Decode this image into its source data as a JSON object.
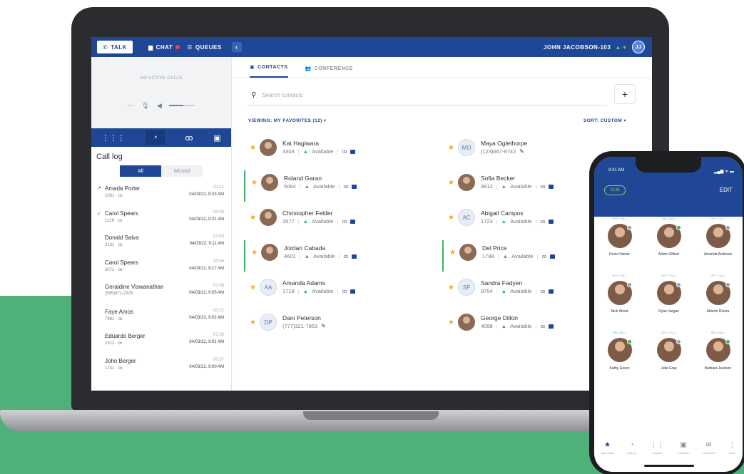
{
  "topbar": {
    "talk": "TALK",
    "chat": "CHAT",
    "queues": "QUEUES",
    "collapse": "‹",
    "user": "JOHN JACOBSON-103",
    "avatar": "JJ"
  },
  "left": {
    "no_calls": "NO ACTIVE CALLS",
    "call_log_title": "Call log",
    "filter_all": "All",
    "filter_missed": "Missed",
    "log": [
      {
        "name": "Amada Porter",
        "sub": "1031 · ꝏ",
        "dur": "01:11",
        "date": "04/03/22, 9:23 AM",
        "arrow": "↗",
        "arrow_color": "#1f4796"
      },
      {
        "name": "Carol Spears",
        "sub": "1126 · ꝏ",
        "dur": "00:00",
        "date": "04/03/22, 9:21 AM",
        "arrow": "↙",
        "arrow_color": "#d9394a"
      },
      {
        "name": "Donald Salva",
        "sub": "2131 · ꝏ",
        "dur": "01:53",
        "date": "04/03/22, 9:11 AM",
        "arrow": "",
        "arrow_color": "#1f4796"
      },
      {
        "name": "Carol Spears",
        "sub": "3571 · ꝏ",
        "dur": "10:06",
        "date": "04/03/22, 9:17 AM",
        "arrow": "",
        "arrow_color": "#1f4796"
      },
      {
        "name": "Geraldine Viswanathan",
        "sub": "(555)971-2325",
        "dur": "01:08",
        "date": "04/03/22, 9:05 AM",
        "arrow": "",
        "arrow_color": "#1f4796"
      },
      {
        "name": "Faye Amos",
        "sub": "7981 · ꝏ",
        "dur": "00:22",
        "date": "04/03/22, 9:02 AM",
        "arrow": "",
        "arrow_color": "#1f4796"
      },
      {
        "name": "Eduardo Berger",
        "sub": "2311 · ꝏ",
        "dur": "01:30",
        "date": "04/03/22, 9:01 AM",
        "arrow": "",
        "arrow_color": "#1f4796"
      },
      {
        "name": "John Berger",
        "sub": "1741 · ꝏ",
        "dur": "00:37",
        "date": "04/03/22, 9:00 AM",
        "arrow": "",
        "arrow_color": "#1f4796"
      }
    ]
  },
  "main": {
    "tab_contacts": "CONTACTS",
    "tab_conference": "CONFERENCE",
    "search_placeholder": "Search contacts",
    "add": "+",
    "viewing": "VIEWING: MY FAVORITES (12) ▾",
    "sort": "SORT: CUSTOM ▾",
    "contacts": [
      {
        "name": "Kat Hagiwara",
        "ext": "3303",
        "status": "Available",
        "initials": "",
        "oncall": false
      },
      {
        "name": "Maya Oglethorpe",
        "ext": "(123)667-8742",
        "status": "",
        "initials": "MO",
        "oncall": false
      },
      {
        "name": "Roland Garan",
        "ext": "5064",
        "status": "Available",
        "initials": "",
        "oncall": true
      },
      {
        "name": "Sofia Becker",
        "ext": "9812",
        "status": "Available",
        "initials": "",
        "oncall": false
      },
      {
        "name": "Christopher Felder",
        "ext": "3577",
        "status": "Available",
        "initials": "",
        "oncall": false
      },
      {
        "name": "Abigail Campos",
        "ext": "1723",
        "status": "Available",
        "initials": "AC",
        "oncall": false
      },
      {
        "name": "Jordan Cabada",
        "ext": "4601",
        "status": "Available",
        "initials": "",
        "oncall": true
      },
      {
        "name": "Del Price",
        "ext": "1788",
        "status": "Available",
        "initials": "",
        "oncall": true
      },
      {
        "name": "Amanda Adams",
        "ext": "1718",
        "status": "Available",
        "initials": "AA",
        "oncall": false
      },
      {
        "name": "Sandra Fadyen",
        "ext": "8754",
        "status": "Available",
        "initials": "SF",
        "oncall": false
      },
      {
        "name": "Dani Peterson",
        "ext": "(777)321-7853",
        "status": "",
        "initials": "DP",
        "oncall": false
      },
      {
        "name": "George Dillon",
        "ext": "4098",
        "status": "Available",
        "initials": "",
        "oncall": false
      }
    ]
  },
  "phone": {
    "time": "9:41 AM",
    "status_icons": "▂▄▆ ᯤ ▬",
    "pill": "3135",
    "edit": "EDIT",
    "people": [
      {
        "status": "OFF CALL",
        "name": "Doris Palmer",
        "on": false
      },
      {
        "status": "ON CALL",
        "name": "Adam Gilbert",
        "on": true
      },
      {
        "status": "OFF CALL",
        "name": "Amanda Andrews",
        "on": false
      },
      {
        "status": "OFF CALL",
        "name": "Nick Wood",
        "on": false
      },
      {
        "status": "OFF CALL",
        "name": "Ryan Vargas",
        "on": false
      },
      {
        "status": "OFF CALL",
        "name": "Alberto Rivera",
        "on": false
      },
      {
        "status": "ON CALL",
        "name": "Kathy Green",
        "on": true
      },
      {
        "status": "OFF CALL",
        "name": "Julie Gray",
        "on": false
      },
      {
        "status": "ON CALL",
        "name": "Barbara Jackson",
        "on": true
      }
    ],
    "nav": [
      "Speeddial",
      "History",
      "Keypad",
      "Contacts",
      "Voicemail",
      "More"
    ]
  },
  "colors": {
    "brand": "#1f4796",
    "green": "#4fb07a",
    "available": "#3bb360",
    "star": "#f1a81b"
  }
}
